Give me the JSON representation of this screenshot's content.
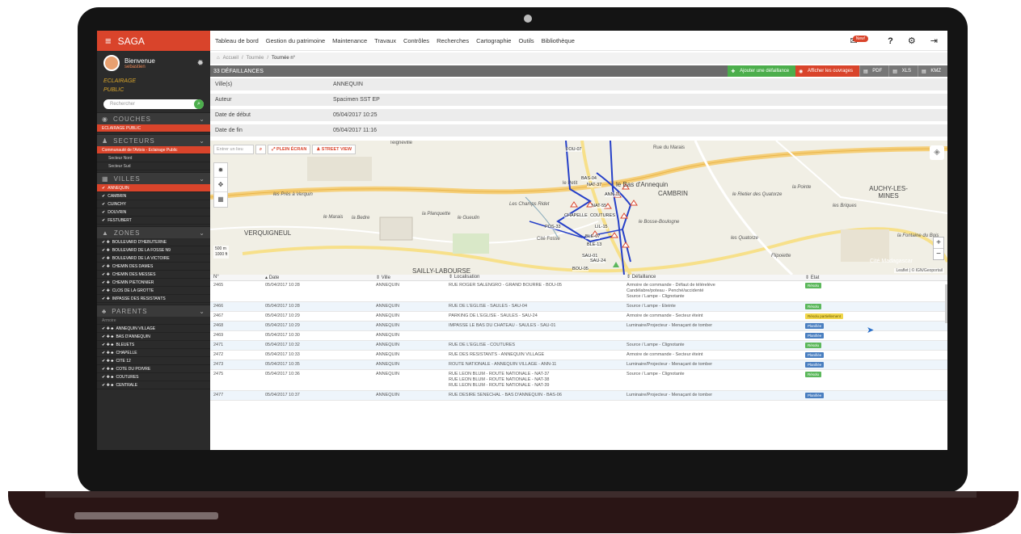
{
  "app": {
    "title": "SAGA"
  },
  "topnav": [
    "Tableau de bord",
    "Gestion du patrimoine",
    "Maintenance",
    "Travaux",
    "Contrôles",
    "Recherches",
    "Cartographie",
    "Outils",
    "Bibliothèque"
  ],
  "topright": {
    "mail_badge": "New!",
    "help": "?"
  },
  "user": {
    "welcome": "Bienvenue",
    "name": "sebastien"
  },
  "logo": {
    "line1": "ECLAIRAGE",
    "line2": "PUBLIC"
  },
  "sidebar": {
    "search_placeholder": "Rechercher",
    "couches": {
      "title": "COUCHES",
      "items": [
        "ECLAIRAGE PUBLIC"
      ]
    },
    "secteurs": {
      "title": "SECTEURS",
      "items": [
        "Communauté de l'Artois - Eclairage Public",
        "Secteur Nord",
        "Secteur Sud"
      ]
    },
    "villes": {
      "title": "VILLES",
      "items": [
        "ANNEQUIN",
        "CAMBRIN",
        "CUINCHY",
        "DOUVRIN",
        "FESTUBERT"
      ]
    },
    "zones": {
      "title": "ZONES",
      "items": [
        "BOULEVARD D'HEBUTERNE",
        "BOULEVARD DE LA FOSSE N9",
        "BOULEVARD DE LA VICTOIRE",
        "CHEMIN DES DAMES",
        "CHEMIN DES MESSES",
        "CHEMIN PIETONNIER",
        "CLOS DE LA GROTTE",
        "IMPASSE DES RESISTANTS"
      ]
    },
    "parents": {
      "title": "PARENTS",
      "filter": "Armoire",
      "items": [
        "ANNEQUIN VILLAGE",
        "BAS D'ANNEQUIN",
        "BLEUETS",
        "CHAPELLE",
        "CITE 12",
        "COTE DU POIVRE",
        "COUTURES",
        "CENTRALE"
      ]
    }
  },
  "breadcrumb": {
    "home": "Accueil",
    "mid": "Tournée",
    "last": "Tournée n°"
  },
  "panel": {
    "title": "33 DÉFAILLANCES",
    "add": "Ajouter une défaillance",
    "show": "Afficher les ouvrages",
    "pdf": "PDF",
    "xls": "XLS",
    "kmz": "KMZ"
  },
  "info": [
    {
      "k": "Ville(s)",
      "v": "ANNEQUIN"
    },
    {
      "k": "Auteur",
      "v": "Spacimen SST EP"
    },
    {
      "k": "Date de début",
      "v": "05/04/2017 10:25"
    },
    {
      "k": "Date de fin",
      "v": "05/04/2017 11:16"
    }
  ],
  "map": {
    "search_placeholder": "Entrer un lieu",
    "fullscreen": "PLEIN ÉCRAN",
    "streetview": "STREET VIEW",
    "scale": [
      "500 m",
      "1000 ft"
    ],
    "attribution": "Leaflet | © IGN/Geoportail",
    "labels": [
      "Teigneville",
      "Rue du Marais",
      "le Bas d'Annequin",
      "CAMBRIN",
      "AUCHY-LES-MINES",
      "VERQUIGNEUL",
      "SAILLY-LABOURSE",
      "Cité Madagascar",
      "Cité Fosse",
      "le Petit",
      "les Près à Verquin",
      "la Planquette",
      "le Gueulin",
      "Les Champs Ridet",
      "le Bosse-Boulogne",
      "les Quatorze",
      "Flipoiette",
      "le Rietier des Quatorze",
      "les Briques",
      "la Pointe",
      "la Fontaine du Bois",
      "le Marais",
      "la Bedre"
    ],
    "points": [
      "FOU-07",
      "BAS-04",
      "NAT-37",
      "NAT-55",
      "ANN-11",
      "CHAPELLE",
      "COUTURES",
      "POS-33",
      "LIL-15",
      "BLE-07",
      "BLE-13",
      "SAU-01",
      "SAU-24",
      "BOU-05"
    ]
  },
  "table": {
    "headers": [
      "N°",
      "Date",
      "Ville",
      "Localisation",
      "Défaillance",
      "Etat"
    ],
    "rows": [
      {
        "n": "2465",
        "date": "05/04/2017 10:28",
        "ville": "ANNEQUIN",
        "loc": [
          "RUE ROGER SALENGRO - GRAND BOURRE - BOU-05"
        ],
        "def": [
          "Armoire de commande - Défaut de télérelève",
          "Candélabre/poteau - Penché/accidenté",
          "Source / Lampe - Clignotante"
        ],
        "etat": "Résolu"
      },
      {
        "n": "2466",
        "date": "05/04/2017 10:28",
        "ville": "ANNEQUIN",
        "loc": [
          "RUE DE L'EGLISE - SAULES - SAU-04"
        ],
        "def": [
          "Source / Lampe - Eteinte"
        ],
        "etat": "Résolu"
      },
      {
        "n": "2467",
        "date": "05/04/2017 10:29",
        "ville": "ANNEQUIN",
        "loc": [
          "PARKING DE L'EGLISE - SAULES - SAU-24"
        ],
        "def": [
          "Armoire de commande - Secteur éteint"
        ],
        "etat": "Résolu partiellement"
      },
      {
        "n": "2468",
        "date": "05/04/2017 10:29",
        "ville": "ANNEQUIN",
        "loc": [
          "IMPASSE LE BAS DU CHATEAU - SAULES - SAU-01"
        ],
        "def": [
          "Luminaire/Projecteur - Menaçant de tomber"
        ],
        "etat": "Planifiée"
      },
      {
        "n": "2469",
        "date": "05/04/2017 10:30",
        "ville": "ANNEQUIN",
        "loc": [
          ""
        ],
        "def": [
          ""
        ],
        "etat": "Planifiée"
      },
      {
        "n": "2471",
        "date": "05/04/2017 10:32",
        "ville": "ANNEQUIN",
        "loc": [
          "RUE DE L'EGLISE - COUTURES"
        ],
        "def": [
          "Source / Lampe - Clignotante"
        ],
        "etat": "Résolu"
      },
      {
        "n": "2472",
        "date": "05/04/2017 10:33",
        "ville": "ANNEQUIN",
        "loc": [
          "RUE DES RESISTANTS - ANNEQUIN VILLAGE"
        ],
        "def": [
          "Armoire de commande - Secteur éteint"
        ],
        "etat": "Planifiée"
      },
      {
        "n": "2473",
        "date": "05/04/2017 10:35",
        "ville": "ANNEQUIN",
        "loc": [
          "ROUTE NATIONALE - ANNEQUIN VILLAGE - ANN-11"
        ],
        "def": [
          "Luminaire/Projecteur - Menaçant de tomber"
        ],
        "etat": "Planifiée"
      },
      {
        "n": "2475",
        "date": "05/04/2017 10:36",
        "ville": "ANNEQUIN",
        "loc": [
          "RUE LEON BLUM - ROUTE NATIONALE - NAT-37",
          "RUE LEON BLUM - ROUTE NATIONALE - NAT-38",
          "RUE LEON BLUM - ROUTE NATIONALE - NAT-39"
        ],
        "def": [
          "Source / Lampe - Clignotante"
        ],
        "etat": "Résolu"
      },
      {
        "n": "2477",
        "date": "05/04/2017 10:37",
        "ville": "ANNEQUIN",
        "loc": [
          "RUE DESIRE SENECHAL - BAS D'ANNEQUIN - BAS-06"
        ],
        "def": [
          "Luminaire/Projecteur - Menaçant de tomber"
        ],
        "etat": "Planifiée"
      }
    ]
  },
  "colors": {
    "accent": "#d9442b",
    "resolu": "#5cb85c",
    "partiel": "#f0d64b",
    "planifiee": "#4a7fc0"
  }
}
